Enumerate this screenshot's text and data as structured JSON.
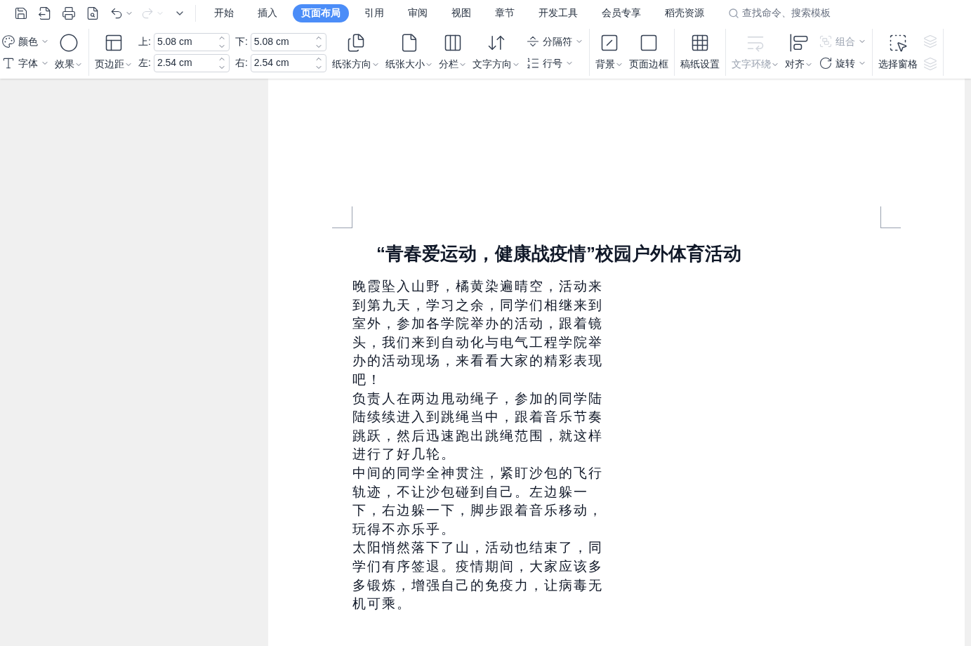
{
  "tabs": [
    {
      "label": "开始",
      "selected": false
    },
    {
      "label": "插入",
      "selected": false
    },
    {
      "label": "页面布局",
      "selected": true
    },
    {
      "label": "引用",
      "selected": false
    },
    {
      "label": "审阅",
      "selected": false
    },
    {
      "label": "视图",
      "selected": false
    },
    {
      "label": "章节",
      "selected": false
    },
    {
      "label": "开发工具",
      "selected": false
    },
    {
      "label": "会员专享",
      "selected": false
    },
    {
      "label": "稻壳资源",
      "selected": false
    }
  ],
  "search": {
    "placeholder": "查找命令、搜索模板"
  },
  "ribbon": [
    {
      "items": [
        {
          "kind": "stack",
          "items": [
            {
              "label": "颜色",
              "dropdown": true,
              "disabled": false
            },
            {
              "label": "字体",
              "dropdown": true,
              "disabled": false
            }
          ]
        },
        {
          "kind": "big",
          "label": "效果",
          "dropdown": true,
          "disabled": false
        }
      ]
    },
    {
      "items": [
        {
          "kind": "big",
          "label": "页边距",
          "dropdown": true,
          "disabled": false
        },
        {
          "kind": "spins",
          "fields": [
            {
              "label": "上:",
              "value": "5.08 cm"
            },
            {
              "label": "下:",
              "value": "5.08 cm"
            },
            {
              "label": "左:",
              "value": "2.54 cm"
            },
            {
              "label": "右:",
              "value": "2.54 cm"
            }
          ]
        },
        {
          "kind": "big",
          "label": "纸张方向",
          "dropdown": true,
          "disabled": false
        },
        {
          "kind": "big",
          "label": "纸张大小",
          "dropdown": true,
          "disabled": false
        },
        {
          "kind": "big",
          "label": "分栏",
          "dropdown": true,
          "disabled": false
        },
        {
          "kind": "big",
          "label": "文字方向",
          "dropdown": true,
          "disabled": false
        },
        {
          "kind": "stack",
          "items": [
            {
              "label": "分隔符",
              "dropdown": true,
              "disabled": false
            },
            {
              "label": "行号",
              "dropdown": true,
              "disabled": false
            }
          ]
        }
      ]
    },
    {
      "items": [
        {
          "kind": "big",
          "label": "背景",
          "dropdown": true,
          "disabled": false
        },
        {
          "kind": "big",
          "label": "页面边框",
          "dropdown": false,
          "disabled": false
        }
      ]
    },
    {
      "items": [
        {
          "kind": "big",
          "label": "稿纸设置",
          "dropdown": false,
          "disabled": false
        }
      ]
    },
    {
      "items": [
        {
          "kind": "big",
          "label": "文字环绕",
          "dropdown": true,
          "disabled": true
        },
        {
          "kind": "big",
          "label": "对齐",
          "dropdown": true,
          "disabled": false
        },
        {
          "kind": "stack",
          "items": [
            {
              "label": "组合",
              "dropdown": true,
              "disabled": true
            },
            {
              "label": "旋转",
              "dropdown": true,
              "disabled": false
            }
          ]
        }
      ]
    },
    {
      "items": [
        {
          "kind": "big",
          "label": "选择窗格",
          "dropdown": false,
          "disabled": false
        },
        {
          "kind": "icons"
        }
      ]
    }
  ],
  "document": {
    "title": "“青春爱运动，健康战疫情”校园户外体育活动",
    "paragraphs": [
      "晚霞坠入山野，橘黄染遍晴空，活动来到第九天，学习之余，同学们相继来到室外，参加各学院举办的活动，跟着镜头，我们来到自动化与电气工程学院举办的活动现场，来看看大家的精彩表现吧！",
      "负责人在两边甩动绳子，参加的同学陆陆续续进入到跳绳当中，跟着音乐节奏跳跃，然后迅速跑出跳绳范围，就这样进行了好几轮。",
      "中间的同学全神贯注，紧盯沙包的飞行轨迹，不让沙包碰到自己。左边躲一下，右边躲一下，脚步跟着音乐移动，玩得不亦乐乎。",
      "太阳悄然落下了山，活动也结束了，同学们有序签退。疫情期间，大家应该多多锻炼，增强自己的免疫力，让病毒无机可乘。"
    ]
  }
}
